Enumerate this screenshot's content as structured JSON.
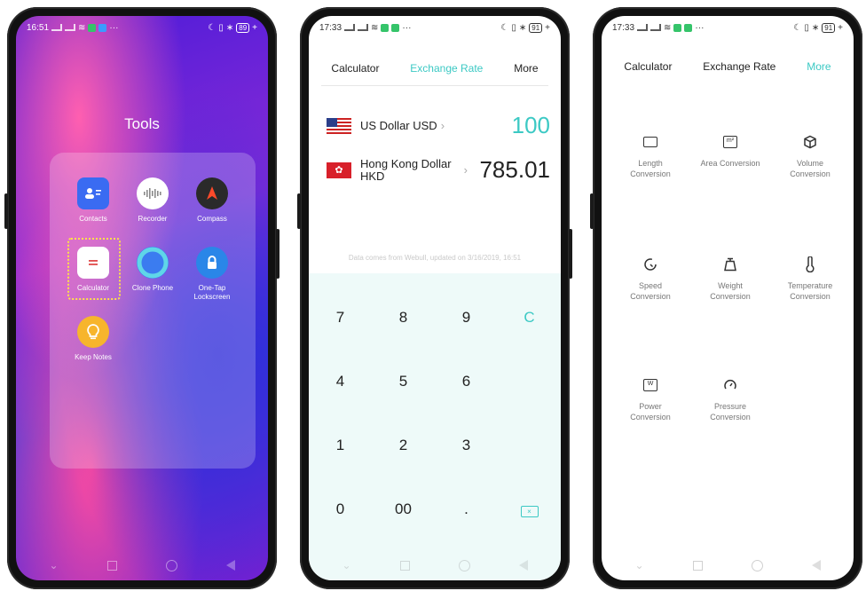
{
  "phone1": {
    "status": {
      "time": "16:51",
      "battery": "89"
    },
    "folder_title": "Tools",
    "apps": [
      {
        "label": "Contacts",
        "icon": "contacts-icon"
      },
      {
        "label": "Recorder",
        "icon": "recorder-icon"
      },
      {
        "label": "Compass",
        "icon": "compass-icon"
      },
      {
        "label": "Calculator",
        "icon": "calculator-icon"
      },
      {
        "label": "Clone Phone",
        "icon": "clone-phone-icon"
      },
      {
        "label": "One-Tap Lockscreen",
        "icon": "lock-icon"
      },
      {
        "label": "Keep Notes",
        "icon": "bulb-icon"
      }
    ],
    "colors": {
      "focus": "#ffe04a"
    }
  },
  "phone2": {
    "status": {
      "time": "17:33",
      "battery": "91"
    },
    "tabs": [
      "Calculator",
      "Exchange Rate",
      "More"
    ],
    "active_tab": "Exchange Rate",
    "from": {
      "name": "US Dollar USD",
      "value": "100"
    },
    "to": {
      "name_line1": "Hong Kong Dollar",
      "name_line2": "HKD",
      "value": "785.01"
    },
    "note": "Data comes from Webull, updated on 3/16/2019, 16:51",
    "keys": [
      [
        "7",
        "8",
        "9",
        "C"
      ],
      [
        "4",
        "5",
        "6",
        ""
      ],
      [
        "1",
        "2",
        "3",
        ""
      ],
      [
        "0",
        "00",
        ".",
        "×"
      ]
    ],
    "colors": {
      "accent": "#3cc9c4",
      "keypad_bg": "#eefaf9"
    }
  },
  "phone3": {
    "status": {
      "time": "17:33",
      "battery": "91"
    },
    "tabs": [
      "Calculator",
      "Exchange Rate",
      "More"
    ],
    "active_tab": "More",
    "units": [
      {
        "line1": "Length",
        "line2": "Conversion",
        "icon": "ruler-icon"
      },
      {
        "line1": "Area Conversion",
        "line2": "",
        "icon": "area-icon"
      },
      {
        "line1": "Volume",
        "line2": "Conversion",
        "icon": "cube-icon"
      },
      {
        "line1": "Speed",
        "line2": "Conversion",
        "icon": "speedometer-icon"
      },
      {
        "line1": "Weight",
        "line2": "Conversion",
        "icon": "weight-icon"
      },
      {
        "line1": "Temperature",
        "line2": "Conversion",
        "icon": "thermometer-icon"
      },
      {
        "line1": "Power",
        "line2": "Conversion",
        "icon": "power-icon"
      },
      {
        "line1": "Pressure",
        "line2": "Conversion",
        "icon": "gauge-icon"
      }
    ],
    "unit_glyphs": {
      "area": "m²",
      "power": "W"
    }
  }
}
